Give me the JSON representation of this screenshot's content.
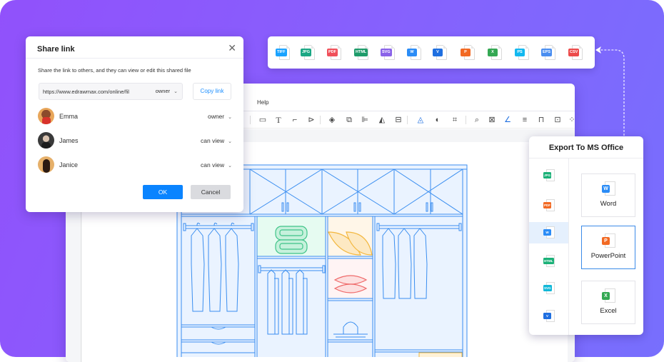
{
  "colors": {
    "accent": "#0a84ff",
    "drawing_line": "#3a8ef0",
    "drawing_fill": "#eaf3ff",
    "towel": "#4fcf97",
    "pillow_yellow": "#f3b73e",
    "pillow_red": "#ef6a6a"
  },
  "editor": {
    "menu_help": "Help",
    "toolbar_icons": [
      "rectangle-icon",
      "text-icon",
      "connector-icon",
      "pointer-icon",
      "layers-icon",
      "group-icon",
      "align-icon",
      "flip-icon",
      "arrange-icon",
      "fill-icon",
      "shape-style-icon",
      "crop-icon",
      "search-icon",
      "format-painter-icon",
      "line-color-icon",
      "line-style-icon",
      "lock-icon",
      "fit-icon",
      "more-icon"
    ]
  },
  "share": {
    "title": "Share link",
    "description": "Share the link to others, and they can view or edit this shared file",
    "link_value": "https://www.edrawmax.com/online/fil",
    "link_permission": "owner",
    "copy_label": "Copy link",
    "members": [
      {
        "name": "Emma",
        "permission": "owner"
      },
      {
        "name": "James",
        "permission": "can view"
      },
      {
        "name": "Janice",
        "permission": "can view"
      }
    ],
    "ok_label": "OK",
    "cancel_label": "Cancel"
  },
  "formats": [
    {
      "label": "TIFF",
      "color": "#1aa3ff"
    },
    {
      "label": "JPG",
      "color": "#1ba784"
    },
    {
      "label": "PDF",
      "color": "#f0505a"
    },
    {
      "label": "HTML",
      "color": "#1e9b6a"
    },
    {
      "label": "SVG",
      "color": "#8a63e8"
    },
    {
      "label": "W",
      "color": "#2b8cf6"
    },
    {
      "label": "V",
      "color": "#1f6fe0"
    },
    {
      "label": "P",
      "color": "#f26a24"
    },
    {
      "label": "X",
      "color": "#34a853"
    },
    {
      "label": "PS",
      "color": "#12b8f0"
    },
    {
      "label": "EPS",
      "color": "#4a8ef0"
    },
    {
      "label": "CSV",
      "color": "#ec4b4b"
    }
  ],
  "export": {
    "title": "Export To MS Office",
    "side_items": [
      {
        "label": "JPG",
        "color": "#1bb178",
        "active": false
      },
      {
        "label": "PDF",
        "color": "#f26a24",
        "active": false
      },
      {
        "label": "W",
        "color": "#2b8cf6",
        "active": true
      },
      {
        "label": "HTML",
        "color": "#1bb178",
        "active": false
      },
      {
        "label": "SVG",
        "color": "#12b8d8",
        "active": false
      },
      {
        "label": "V",
        "color": "#1f6fe0",
        "active": false
      }
    ],
    "cards": [
      {
        "label": "Word",
        "letter": "W",
        "color": "#2b8cf6",
        "active": false
      },
      {
        "label": "PowerPoint",
        "letter": "P",
        "color": "#f26a24",
        "active": true
      },
      {
        "label": "Excel",
        "letter": "X",
        "color": "#34a853",
        "active": false
      }
    ]
  }
}
